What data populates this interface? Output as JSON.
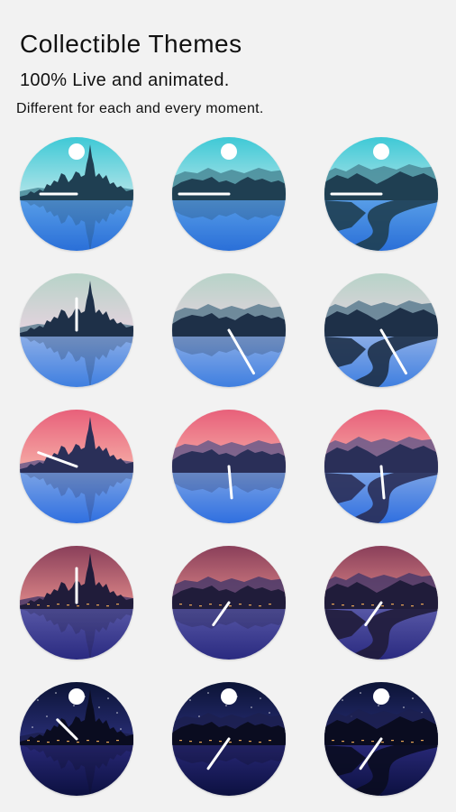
{
  "header": {
    "title": "Collectible Themes",
    "subtitle": "100% Live and animated.",
    "description": "Different for each and every moment."
  },
  "scene_types": [
    "city-skyline",
    "lake-hills",
    "river-valley"
  ],
  "rows": [
    {
      "time": "morning",
      "sky_top": "#3ec9d6",
      "sky_bottom": "#b9e6ea",
      "ground_top": "#5aa0e8",
      "ground_bottom": "#2a6fd8",
      "land": "#1f3f52",
      "far": "#4a8a98",
      "sun": "#ffffff",
      "sun_visible": false,
      "moon": true,
      "stars": false,
      "lights": false,
      "hands": [
        [
          -90,
          40
        ],
        [
          -90,
          55
        ],
        [
          -90,
          55
        ]
      ]
    },
    {
      "time": "noon",
      "sky_top": "#b7d3c8",
      "sky_bottom": "#e8d3e0",
      "ground_top": "#8fb0e8",
      "ground_bottom": "#3f7fe0",
      "land": "#1e3048",
      "far": "#5d7d90",
      "sun": "#ffffff",
      "sun_visible": true,
      "moon": false,
      "stars": false,
      "lights": false,
      "hands": [
        [
          0,
          35
        ],
        [
          150,
          55
        ],
        [
          150,
          55
        ]
      ]
    },
    {
      "time": "sunset",
      "sky_top": "#e8607a",
      "sky_bottom": "#f6b0a8",
      "ground_top": "#7fa6e6",
      "ground_bottom": "#2f6fe0",
      "land": "#2a2f58",
      "far": "#6a5a8a",
      "sun": "#ffffff",
      "sun_visible": false,
      "moon": false,
      "stars": false,
      "lights": false,
      "hands": [
        [
          -70,
          45
        ],
        [
          175,
          35
        ],
        [
          175,
          35
        ]
      ]
    },
    {
      "time": "dusk",
      "sky_top": "#8a3f5a",
      "sky_bottom": "#e08a8a",
      "ground_top": "#5a5aa8",
      "ground_bottom": "#2a2a80",
      "land": "#201c3a",
      "far": "#4a3a6a",
      "sun": "#ffd9c8",
      "sun_visible": true,
      "moon": false,
      "stars": false,
      "lights": true,
      "hands": [
        [
          0,
          38
        ],
        [
          215,
          30
        ],
        [
          215,
          30
        ]
      ]
    },
    {
      "time": "night",
      "sky_top": "#0c1436",
      "sky_bottom": "#2a2f7a",
      "ground_top": "#2a2a7a",
      "ground_bottom": "#0c1040",
      "land": "#0a0c20",
      "far": "#1c2050",
      "sun": "#ffffff",
      "sun_visible": false,
      "moon": true,
      "stars": true,
      "lights": true,
      "hands": [
        [
          -45,
          30
        ],
        [
          215,
          40
        ],
        [
          215,
          40
        ]
      ]
    }
  ]
}
